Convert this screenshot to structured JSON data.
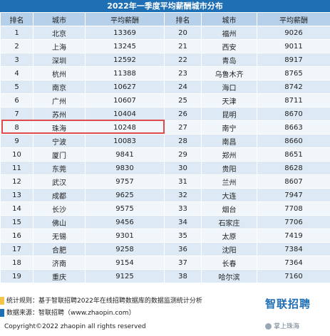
{
  "title": "2022年一季度平均薪酬城市分布",
  "headers": [
    "排名",
    "城市",
    "平均薪酬",
    "排名",
    "城市",
    "平均薪酬"
  ],
  "rows": [
    [
      "1",
      "北京",
      "13369",
      "20",
      "福州",
      "9026"
    ],
    [
      "2",
      "上海",
      "13245",
      "21",
      "西安",
      "9011"
    ],
    [
      "3",
      "深圳",
      "12592",
      "22",
      "青岛",
      "8917"
    ],
    [
      "4",
      "杭州",
      "11388",
      "23",
      "乌鲁木齐",
      "8765"
    ],
    [
      "5",
      "南京",
      "10627",
      "24",
      "海口",
      "8742"
    ],
    [
      "6",
      "广州",
      "10607",
      "25",
      "天津",
      "8711"
    ],
    [
      "7",
      "苏州",
      "10404",
      "26",
      "昆明",
      "8670"
    ],
    [
      "8",
      "珠海",
      "10248",
      "27",
      "南宁",
      "8663"
    ],
    [
      "9",
      "宁波",
      "10083",
      "28",
      "南昌",
      "8660"
    ],
    [
      "10",
      "厦门",
      "9841",
      "29",
      "郑州",
      "8651"
    ],
    [
      "11",
      "东莞",
      "9830",
      "30",
      "贵阳",
      "8628"
    ],
    [
      "12",
      "武汉",
      "9757",
      "31",
      "兰州",
      "8607"
    ],
    [
      "13",
      "成都",
      "9625",
      "32",
      "大连",
      "7947"
    ],
    [
      "14",
      "长沙",
      "9575",
      "33",
      "烟台",
      "7708"
    ],
    [
      "15",
      "佛山",
      "9456",
      "34",
      "石家庄",
      "7706"
    ],
    [
      "16",
      "无锡",
      "9301",
      "35",
      "太原",
      "7419"
    ],
    [
      "17",
      "合肥",
      "9258",
      "36",
      "沈阳",
      "7384"
    ],
    [
      "18",
      "济南",
      "9154",
      "37",
      "长春",
      "7364"
    ],
    [
      "19",
      "重庆",
      "9125",
      "38",
      "哈尔滨",
      "7160"
    ]
  ],
  "footnotes": {
    "rule": "统计规则：基于智联招聘2022年在线招聘数据库的数据监测统计分析",
    "source": "数据来源：智联招聘（www.zhaopin.com）"
  },
  "copyright": "Copyright©2022 zhaopin all rights reserved",
  "logo": "智联招聘",
  "watermark": "掌上珠海",
  "colors": {
    "header_bar": "#1f6fb5",
    "column_header": "#b7d0ea",
    "row_odd": "#dde9f5",
    "row_even": "#f1f6fb",
    "highlight_border": "#e04a4a",
    "footnote_mark_1": "#f3c64a",
    "footnote_mark_2": "#1f6fb5"
  }
}
